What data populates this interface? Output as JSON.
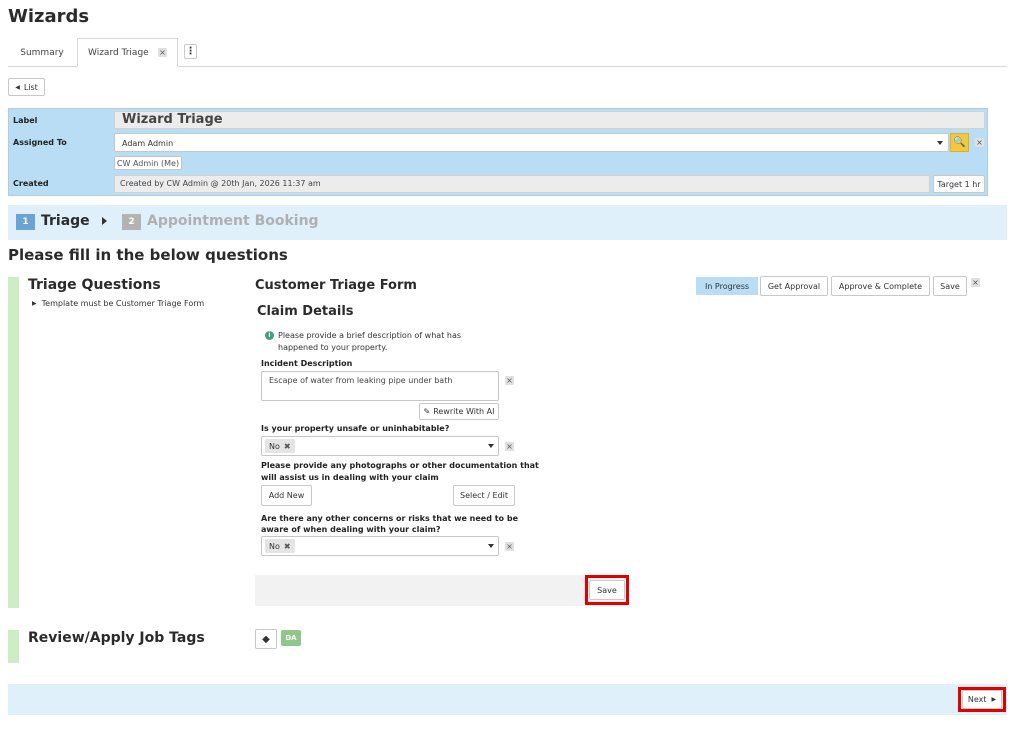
{
  "page": {
    "title": "Wizards"
  },
  "tabs": [
    {
      "label": "Summary"
    },
    {
      "label": "Wizard Triage"
    }
  ],
  "list_button": "List",
  "form": {
    "label_label": "Label",
    "label_value": "Wizard Triage",
    "assigned_label": "Assigned To",
    "assigned_value": "Adam Admin",
    "assigned_chip": "CW Admin (Me)",
    "created_label": "Created",
    "created_value": "Created by CW Admin @ 20th Jan, 2026 11:37 am",
    "target_button": "Target 1 hr"
  },
  "steps": [
    {
      "number": "1",
      "label": "Triage"
    },
    {
      "number": "2",
      "label": "Appointment Booking"
    }
  ],
  "instruction": "Please fill in the below questions",
  "triage": {
    "title": "Triage Questions",
    "note": "Template must be Customer Triage Form",
    "form_title": "Customer Triage Form",
    "status_badge": "In Progress",
    "get_approval": "Get Approval",
    "approve_complete": "Approve & Complete",
    "save": "Save",
    "section_title": "Claim Details",
    "info_line1": "Please provide a brief description of what has",
    "info_line2": "happened to your property.",
    "incident_label": "Incident Description",
    "incident_value": "Escape of water from leaking pipe under bath",
    "rewrite_button": "Rewrite With AI",
    "unsafe_label": "Is your property unsafe or uninhabitable?",
    "unsafe_value": "No",
    "photos_label_line1": "Please provide any photographs or other documentation that",
    "photos_label_line2": "will assist us in dealing with your claim",
    "add_new": "Add New",
    "select_edit": "Select / Edit",
    "concerns_label_line1": "Are there any other concerns or risks that we need to be",
    "concerns_label_line2": "aware of when dealing with your claim?",
    "concerns_value": "No",
    "bottom_save": "Save"
  },
  "tags": {
    "title": "Review/Apply Job Tags",
    "tag_badge": "DA"
  },
  "footer": {
    "next": "Next"
  },
  "colors": {
    "panel_blue": "#b9ddf4",
    "light_blue": "#dff0fb",
    "green_bar": "#cdeec4",
    "step_active": "#6aa3d6",
    "step_inactive": "#b3b3b3",
    "highlight_red": "#e00000",
    "search_yellow": "#f3c93b",
    "tag_green": "#8fc68a"
  }
}
